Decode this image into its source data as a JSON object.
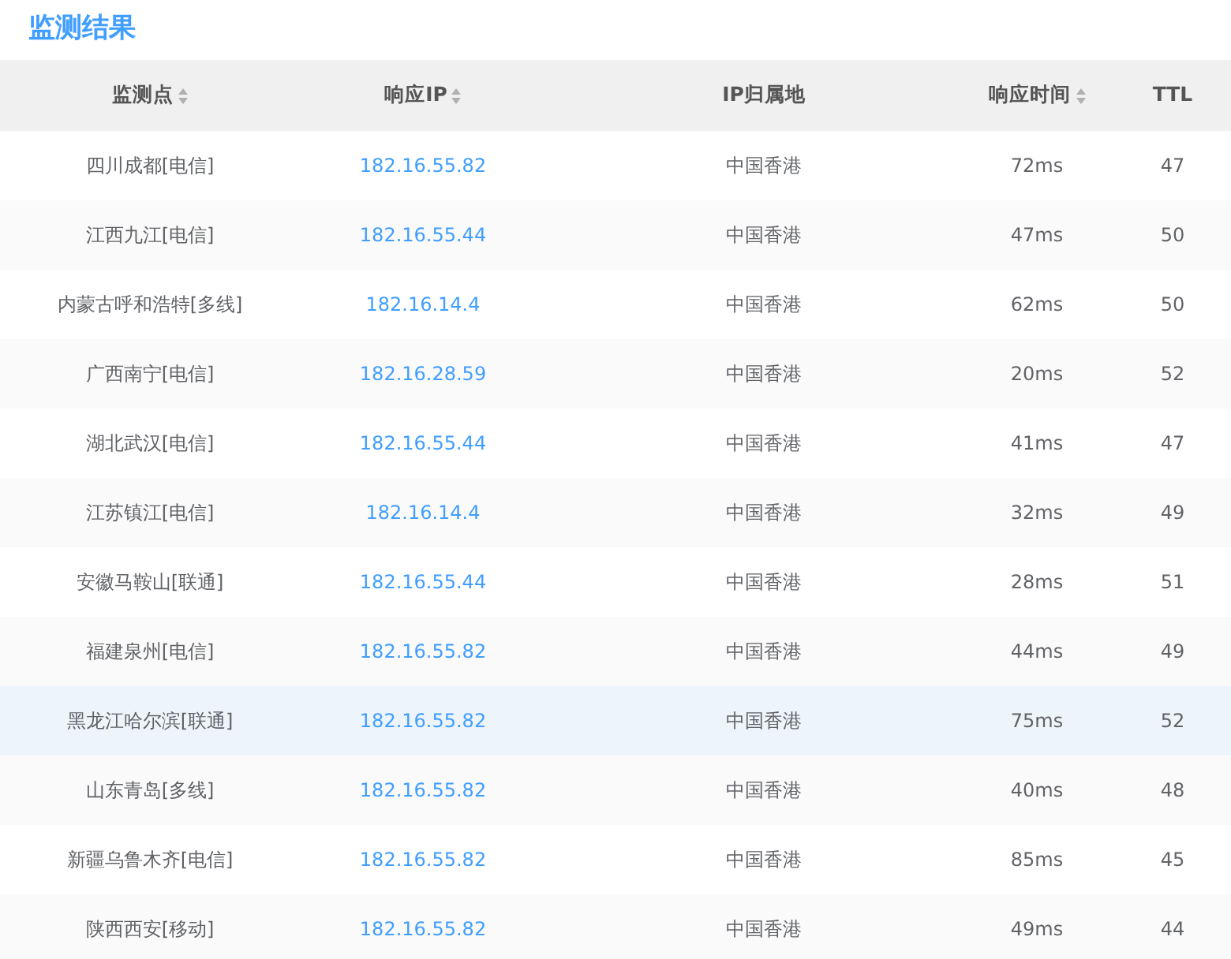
{
  "title": "监测结果",
  "table": {
    "columns": [
      {
        "label": "监测点",
        "sortable": true
      },
      {
        "label": "响应IP",
        "sortable": true
      },
      {
        "label": "IP归属地",
        "sortable": false
      },
      {
        "label": "响应时间",
        "sortable": true
      },
      {
        "label": "TTL",
        "sortable": false
      }
    ],
    "rows": [
      {
        "point": "四川成都[电信]",
        "ip": "182.16.55.82",
        "location": "中国香港",
        "time": "72ms",
        "ttl": "47",
        "highlighted": false
      },
      {
        "point": "江西九江[电信]",
        "ip": "182.16.55.44",
        "location": "中国香港",
        "time": "47ms",
        "ttl": "50",
        "highlighted": false
      },
      {
        "point": "内蒙古呼和浩特[多线]",
        "ip": "182.16.14.4",
        "location": "中国香港",
        "time": "62ms",
        "ttl": "50",
        "highlighted": false
      },
      {
        "point": "广西南宁[电信]",
        "ip": "182.16.28.59",
        "location": "中国香港",
        "time": "20ms",
        "ttl": "52",
        "highlighted": false
      },
      {
        "point": "湖北武汉[电信]",
        "ip": "182.16.55.44",
        "location": "中国香港",
        "time": "41ms",
        "ttl": "47",
        "highlighted": false
      },
      {
        "point": "江苏镇江[电信]",
        "ip": "182.16.14.4",
        "location": "中国香港",
        "time": "32ms",
        "ttl": "49",
        "highlighted": false
      },
      {
        "point": "安徽马鞍山[联通]",
        "ip": "182.16.55.44",
        "location": "中国香港",
        "time": "28ms",
        "ttl": "51",
        "highlighted": false
      },
      {
        "point": "福建泉州[电信]",
        "ip": "182.16.55.82",
        "location": "中国香港",
        "time": "44ms",
        "ttl": "49",
        "highlighted": false
      },
      {
        "point": "黑龙江哈尔滨[联通]",
        "ip": "182.16.55.82",
        "location": "中国香港",
        "time": "75ms",
        "ttl": "52",
        "highlighted": true
      },
      {
        "point": "山东青岛[多线]",
        "ip": "182.16.55.82",
        "location": "中国香港",
        "time": "40ms",
        "ttl": "48",
        "highlighted": false
      },
      {
        "point": "新疆乌鲁木齐[电信]",
        "ip": "182.16.55.82",
        "location": "中国香港",
        "time": "85ms",
        "ttl": "45",
        "highlighted": false
      },
      {
        "point": "陕西西安[移动]",
        "ip": "182.16.55.82",
        "location": "中国香港",
        "time": "49ms",
        "ttl": "44",
        "highlighted": false
      }
    ]
  }
}
